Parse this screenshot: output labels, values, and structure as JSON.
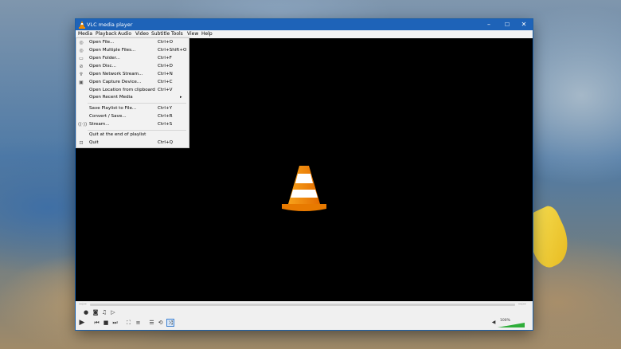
{
  "window": {
    "title": "VLC media player",
    "accent_color": "#1e63b8"
  },
  "menubar": {
    "items": [
      "Media",
      "Playback",
      "Audio",
      "Video",
      "Subtitle",
      "Tools",
      "View",
      "Help"
    ]
  },
  "media_menu": {
    "items": [
      {
        "label": "Open File...",
        "shortcut": "Ctrl+O",
        "icon": "file-icon"
      },
      {
        "label": "Open Multiple Files...",
        "shortcut": "Ctrl+Shift+O",
        "icon": "files-icon"
      },
      {
        "label": "Open Folder...",
        "shortcut": "Ctrl+F",
        "icon": "folder-icon"
      },
      {
        "label": "Open Disc...",
        "shortcut": "Ctrl+D",
        "icon": "disc-icon"
      },
      {
        "label": "Open Network Stream...",
        "shortcut": "Ctrl+N",
        "icon": "network-icon"
      },
      {
        "label": "Open Capture Device...",
        "shortcut": "Ctrl+C",
        "icon": "capture-icon"
      },
      {
        "label": "Open Location from clipboard",
        "shortcut": "Ctrl+V",
        "icon": ""
      },
      {
        "label": "Open Recent Media",
        "shortcut": "",
        "icon": "",
        "submenu": true
      },
      {
        "label": "Save Playlist to File...",
        "shortcut": "Ctrl+Y",
        "icon": ""
      },
      {
        "label": "Convert / Save...",
        "shortcut": "Ctrl+R",
        "icon": ""
      },
      {
        "label": "Stream...",
        "shortcut": "Ctrl+S",
        "icon": "stream-icon"
      },
      {
        "label": "Quit at the end of playlist",
        "shortcut": "",
        "icon": ""
      },
      {
        "label": "Quit",
        "shortcut": "Ctrl+Q",
        "icon": "quit-icon"
      }
    ]
  },
  "controls": {
    "elapsed": "--:--",
    "remaining": "--:--",
    "volume_percent": "100%",
    "volume_level": 1.0
  }
}
